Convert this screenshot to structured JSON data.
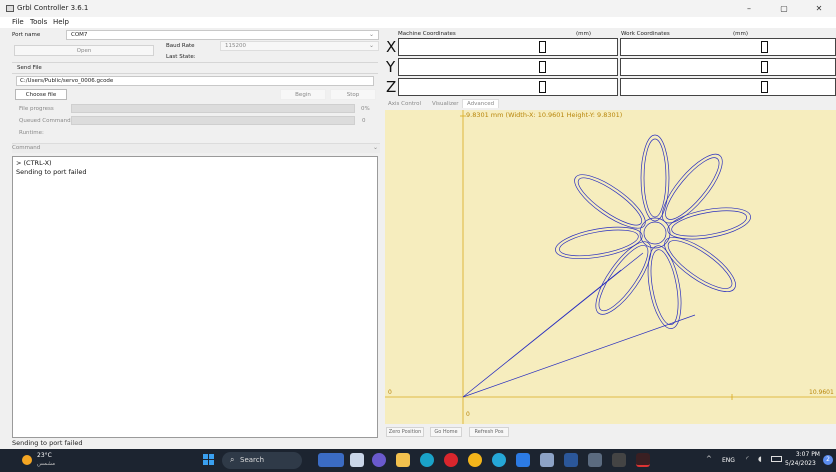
{
  "window": {
    "title": "Grbl Controller 3.6.1",
    "controls": [
      "–",
      "▢",
      "✕"
    ]
  },
  "menu": [
    "File",
    "Tools",
    "Help"
  ],
  "connection": {
    "port_label": "Port name",
    "port_value": "COM7",
    "open_label": "Open",
    "baud_label": "Baud Rate",
    "baud_value": "115200",
    "last_state_label": "Last State:"
  },
  "send_file": {
    "section_label": "Send File",
    "path": "C:/Users/Public/servo_0006.gcode",
    "choose_label": "Choose file",
    "begin_label": "Begin",
    "stop_label": "Stop",
    "file_progress_label": "File progress",
    "file_progress_value": "0%",
    "file_progress_fraction": 0,
    "queued_label": "Queued Commands",
    "queued_value": "0",
    "runtime_label": "Runtime:"
  },
  "command": {
    "label": "Command",
    "log": [
      "> (CTRL-X)",
      "Sending to port failed"
    ]
  },
  "coordinates": {
    "machine_label": "Machine Coordinates",
    "work_label": "Work Coordinates",
    "unit": "(mm)",
    "axes": [
      "X",
      "Y",
      "Z"
    ],
    "machine_values": [
      "0",
      "0",
      "0"
    ],
    "work_values": [
      "0",
      "0",
      "0"
    ]
  },
  "tabs": [
    "Axis Control",
    "Visualizer",
    "Advanced"
  ],
  "visualizer": {
    "dimension_text": "9.8301 mm  (Width-X: 10.9601  Height-Y: 9.8301)",
    "x_min_label": "0",
    "x_max_label": "10.9601",
    "y_min_label": "0",
    "colors": {
      "background": "#f6edbe",
      "axis": "#d9a91c",
      "path": "#2a2fbf"
    }
  },
  "vis_buttons": [
    "Zero Position",
    "Go Home",
    "Refresh Pos"
  ],
  "status_bar": "Sending to port failed",
  "taskbar": {
    "weather_temp": "23°C",
    "weather_text": "مشمس",
    "search_label": "Search",
    "lang": "ENG",
    "time": "3:07 PM",
    "date": "5/24/2023",
    "notification_count": "2"
  }
}
